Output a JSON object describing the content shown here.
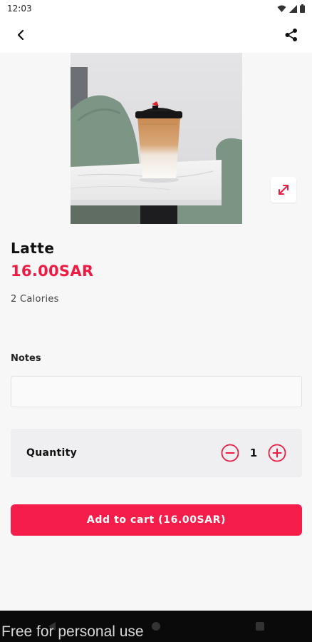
{
  "status": {
    "time": "12:03"
  },
  "product": {
    "name": "Latte",
    "price": "16.00SAR",
    "calories": "2 Calories"
  },
  "notes": {
    "label": "Notes",
    "value": "",
    "placeholder": ""
  },
  "quantity": {
    "label": "Quantity",
    "value": "1"
  },
  "cart_button": {
    "label": "Add to cart (16.00SAR)"
  },
  "watermark": "Free for personal use",
  "colors": {
    "accent": "#f51d4a",
    "price": "#ee1b43",
    "background": "#f7f7f7"
  },
  "icons": {
    "back": "back-arrow-icon",
    "share": "share-icon",
    "expand": "expand-icon",
    "minus": "minus-circle-icon",
    "plus": "plus-circle-icon"
  }
}
